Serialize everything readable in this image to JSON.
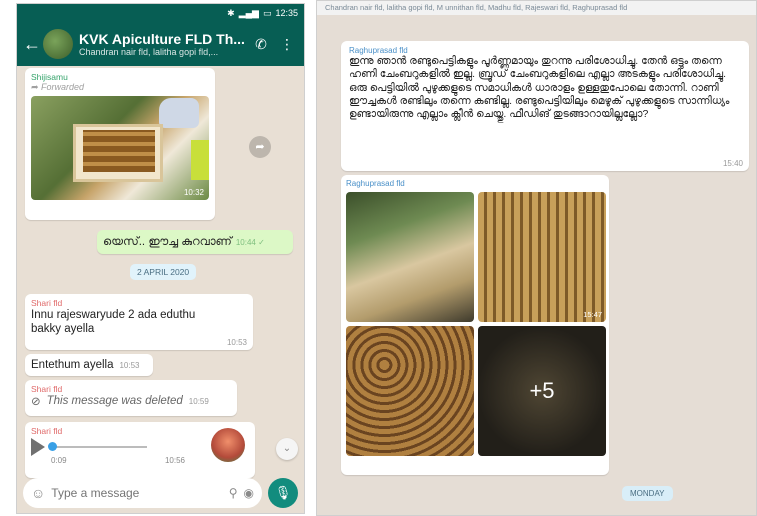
{
  "left": {
    "status_time": "12:35",
    "header": {
      "title": "KVK Apiculture FLD Th...",
      "subtitle": "Chandran nair fld, lalitha gopi fld,..."
    },
    "messages": {
      "m1": {
        "sender": "Shijisamu",
        "forwarded": "Forwarded",
        "photo_time": "10:32"
      },
      "m2": {
        "text": "യെസ്.. ഈച്ച കുറവാണ്",
        "time": "10:44 ✓"
      },
      "date": "2 APRIL 2020",
      "m3": {
        "sender": "Shari fld",
        "text": "Innu rajeswaryude 2 ada eduthu bakky ayella",
        "time": "10:53"
      },
      "m4": {
        "text": "Entethum ayella",
        "time": "10:53"
      },
      "m5": {
        "sender": "Shari fld",
        "text": "This message was deleted",
        "time": "10:59"
      },
      "m6": {
        "sender": "Shari fld",
        "elapsed": "0:09",
        "time": "10:56"
      }
    },
    "input": {
      "placeholder": "Type a message"
    }
  },
  "right": {
    "members": "Chandran nair fld, lalitha gopi fld, M unnithan fld, Madhu fld, Rajeswari fld, Raghuprasad fld",
    "msg1": {
      "sender": "Raghuprasad fld",
      "text": "ഇന്നു ഞാൻ രണ്ടുപെട്ടികളും പൂർണ്ണമായും തുറന്നു പരിശോധിച്ചു. തേൻ ഒട്ടും തന്നെ ഹണി ചേംബറുകളിൽ ഇല്ല. ബ്രൂഡ് ചേംബറുകളിലെ എല്ലാ അടകളും പരിശോധിച്ചു. ഒരു പെട്ടിയിൽ പുഴുക്കളുടെ സമാധികൾ ധാരാളം ഉള്ളതുപോലെ തോന്നി. റാണി ഈച്ചകൾ രണ്ടിലും തന്നെ കണ്ടില്ല. രണ്ടുപെട്ടിയിലും മെഴുക് പുഴുക്കളുടെ സാന്നിധ്യം ഉണ്ടായിരുന്നു എല്ലാം ക്ലീൻ ചെയ്തു. ഫീഡിങ് തുടങ്ങാറായില്ലല്ലോ?",
      "time": "15:40"
    },
    "msg2": {
      "sender": "Raghuprasad fld",
      "time": "15:47",
      "more": "+5"
    },
    "day_pill": "MONDAY"
  }
}
